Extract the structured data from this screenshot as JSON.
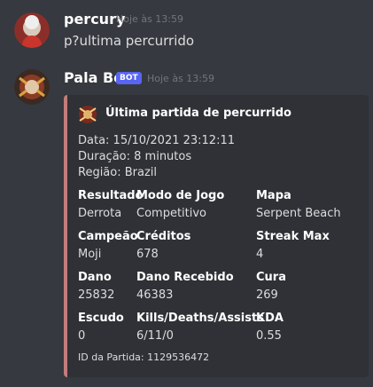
{
  "messages": [
    {
      "author": "percury",
      "timestamp": "Hoje às 13:59",
      "content": "p?ultima percurrido"
    },
    {
      "author": "Pala Bot",
      "badge": "BOT",
      "timestamp": "Hoje às 13:59"
    }
  ],
  "embed": {
    "title": "Última partida de percurrido",
    "description": [
      "Data: 15/10/2021 23:12:11",
      "Duração: 8 minutos",
      "Região: Brazil"
    ],
    "fields": [
      {
        "name": "Resultado",
        "value": "Derrota"
      },
      {
        "name": "Modo de Jogo",
        "value": "Competitivo"
      },
      {
        "name": "Mapa",
        "value": "Serpent Beach"
      },
      {
        "name": "Campeão",
        "value": "Moji"
      },
      {
        "name": "Créditos",
        "value": "678"
      },
      {
        "name": "Streak Max",
        "value": "4"
      },
      {
        "name": "Dano",
        "value": "25832"
      },
      {
        "name": "Dano Recebido",
        "value": "46383"
      },
      {
        "name": "Cura",
        "value": "269"
      },
      {
        "name": "Escudo",
        "value": "0"
      },
      {
        "name": "Kills/Deaths/Assists",
        "value": "6/11/0"
      },
      {
        "name": "KDA",
        "value": "0.55"
      }
    ],
    "footer": "ID da Partida: 1129536472",
    "accent_color": "#c27c7c"
  },
  "icons": {
    "user_avatar": "user-avatar-icon",
    "bot_avatar": "bot-avatar-icon",
    "embed_author": "paladins-emblem-icon"
  }
}
